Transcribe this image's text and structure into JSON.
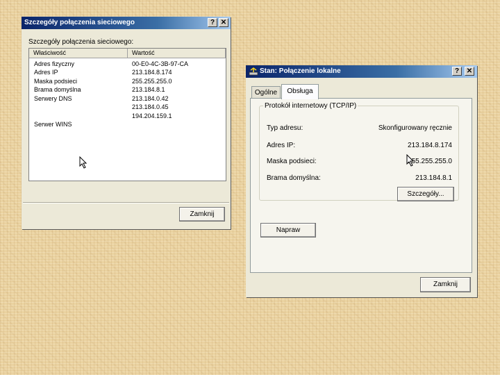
{
  "dialog_left": {
    "title": "Szczegóły połączenia sieciowego",
    "help_label": "?",
    "close_label": "✕",
    "section_label": "Szczegóły połączenia sieciowego:",
    "columns": [
      "Właściwość",
      "Wartość"
    ],
    "properties": [
      "Adres fizyczny",
      "Adres IP",
      "Maska podsieci",
      "Brama domyślna",
      "Serwery DNS",
      "",
      "",
      "",
      "Serwer WINS"
    ],
    "values": [
      "00-E0-4C-3B-97-CA",
      "213.184.8.174",
      "255.255.255.0",
      "213.184.8.1",
      "213.184.0.42",
      "213.184.0.45",
      "194.204.159.1",
      "",
      ""
    ],
    "close_button": "Zamknij"
  },
  "dialog_right": {
    "title": "Stan: Połączenie lokalne",
    "help_label": "?",
    "close_label": "✕",
    "tabs": [
      "Ogólne",
      "Obsługa"
    ],
    "active_tab": "Obsługa",
    "group_title": "Protokół internetowy (TCP/IP)",
    "rows": [
      {
        "label": "Typ adresu:",
        "value": "Skonfigurowany ręcznie"
      },
      {
        "label": "Adres IP:",
        "value": "213.184.8.174"
      },
      {
        "label": "Maska podsieci:",
        "value": "255.255.255.0"
      },
      {
        "label": "Brama domyślna:",
        "value": "213.184.8.1"
      }
    ],
    "details_button": "Szczegóły...",
    "repair_button": "Napraw",
    "close_button": "Zamknij"
  },
  "colors": {
    "titlebar_start": "#0a246a",
    "titlebar_end": "#a6caf0",
    "dialog_face": "#ece9d8",
    "background": "#ead2a0"
  }
}
